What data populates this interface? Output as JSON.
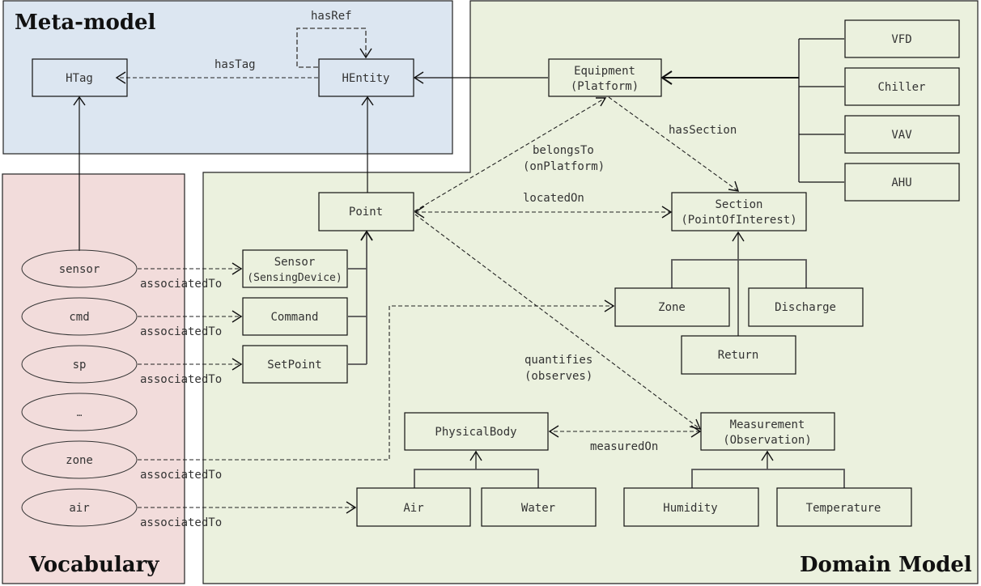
{
  "panels": {
    "meta_model": {
      "title": "Meta-model",
      "color": "#dce6f1"
    },
    "vocabulary": {
      "title": "Vocabulary",
      "color": "#f2dcdb"
    },
    "domain_model": {
      "title": "Domain Model",
      "color": "#ebf1de"
    }
  },
  "classes": {
    "htag": "HTag",
    "hentity": "HEntity",
    "equipment": [
      "Equipment",
      "(Platform)"
    ],
    "vfd": "VFD",
    "chiller": "Chiller",
    "vav": "VAV",
    "ahu": "AHU",
    "point": "Point",
    "section": [
      "Section",
      "(PointOfInterest)"
    ],
    "sensor": [
      "Sensor",
      "(SensingDevice)"
    ],
    "command": "Command",
    "setpoint": "SetPoint",
    "zone": "Zone",
    "discharge": "Discharge",
    "return": "Return",
    "physical_body": "PhysicalBody",
    "measurement": [
      "Measurement",
      "(Observation)"
    ],
    "air": "Air",
    "water": "Water",
    "humidity": "Humidity",
    "temperature": "Temperature"
  },
  "tags": [
    "sensor",
    "cmd",
    "sp",
    "…",
    "zone",
    "air"
  ],
  "relations": {
    "has_ref": "hasRef",
    "has_tag": "hasTag",
    "has_section": "hasSection",
    "belongs_to": [
      "belongsTo",
      "(onPlatform)"
    ],
    "located_on": "locatedOn",
    "quantifies": [
      "quantifies",
      "(observes)"
    ],
    "measured_on": "measuredOn",
    "associated_to": "associatedTo"
  }
}
